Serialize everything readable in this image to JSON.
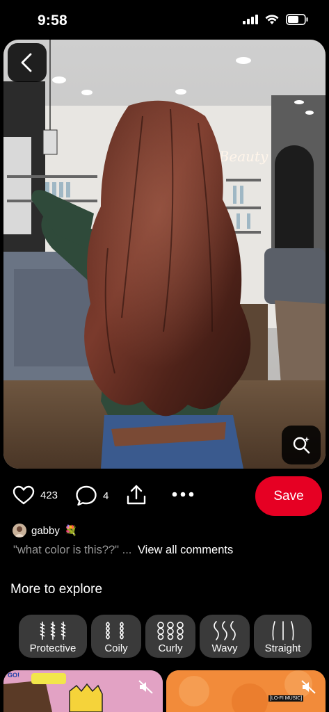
{
  "status_bar": {
    "time": "9:58",
    "icons": [
      "cellular-signal-icon",
      "wifi-icon",
      "battery-icon"
    ]
  },
  "pin": {
    "icons": [
      "back-arrow-icon",
      "visual-search-icon"
    ],
    "scene_text": "Beauty"
  },
  "actions": {
    "likes_count": "423",
    "comments_count": "4",
    "save_label": "Save",
    "icons": [
      "heart-icon",
      "comment-icon",
      "share-icon",
      "more-icon"
    ]
  },
  "author": {
    "name": "gabby",
    "emoji": "💐"
  },
  "comment": {
    "preview": "\"what color is this??\" ...",
    "view_all": "View all comments"
  },
  "explore": {
    "title": "More to explore",
    "chips": [
      {
        "label": "Protective"
      },
      {
        "label": "Coily"
      },
      {
        "label": "Curly"
      },
      {
        "label": "Wavy"
      },
      {
        "label": "Straight"
      }
    ]
  },
  "thumbnails": [
    {
      "badge": "GO!",
      "icon": "mute-icon"
    },
    {
      "badge": "[LO-FI MUSIC]",
      "icon": "mute-icon"
    }
  ],
  "colors": {
    "save": "#e60023",
    "chip_bg": "#3a3a3a",
    "background": "#000000"
  }
}
